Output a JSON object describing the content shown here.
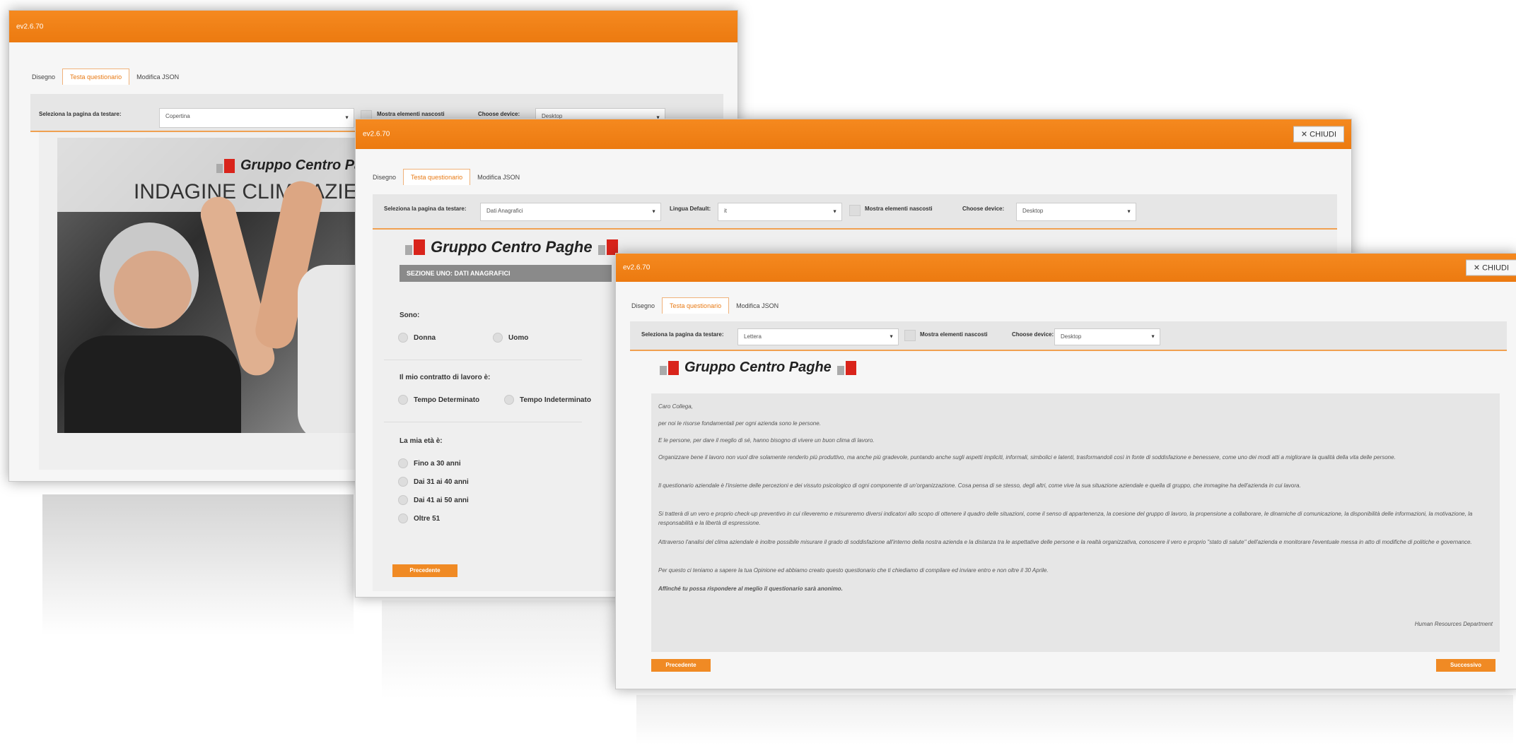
{
  "window1": {
    "version": "ev2.6.70",
    "tabs": [
      "Disegno",
      "Testa questionario",
      "Modifica JSON"
    ],
    "page_label": "Seleziona la pagina da testare:",
    "page_value": "Copertina",
    "show_hidden_label": "Mostra elementi nascosti",
    "device_label": "Choose device:",
    "device_value": "Desktop",
    "brand": "Gruppo Centro Paghe",
    "cover_title": "INDAGINE CLIMA AZIEN"
  },
  "window2": {
    "version": "ev2.6.70",
    "close_label": "CHIUDI",
    "tabs": [
      "Disegno",
      "Testa questionario",
      "Modifica JSON"
    ],
    "page_label": "Seleziona la pagina da testare:",
    "page_value": "Dati Anagrafici",
    "lang_label": "Lingua Default:",
    "lang_value": "it",
    "show_hidden_label": "Mostra elementi nascosti",
    "device_label": "Choose device:",
    "device_value": "Desktop",
    "brand": "Gruppo Centro Paghe",
    "section_title": "SEZIONE UNO: DATI ANAGRAFICI",
    "q1": "Sono:",
    "q1_options": [
      "Donna",
      "Uomo"
    ],
    "q2": "Il mio contratto di lavoro è:",
    "q2_options": [
      "Tempo Determinato",
      "Tempo Indeterminato"
    ],
    "q3": "La mia età è:",
    "q3_options": [
      "Fino a 30 anni",
      "Dai 31 ai 40 anni",
      "Dai 41 ai 50 anni",
      "Oltre 51"
    ],
    "prev_label": "Precedente"
  },
  "window3": {
    "version": "ev2.6.70",
    "close_label": "CHIUDI",
    "tabs": [
      "Disegno",
      "Testa questionario",
      "Modifica JSON"
    ],
    "page_label": "Seleziona la pagina da testare:",
    "page_value": "Lettera",
    "show_hidden_label": "Mostra elementi nascosti",
    "device_label": "Choose device:",
    "device_value": "Desktop",
    "brand": "Gruppo Centro Paghe",
    "letter": [
      "Caro Collega,",
      "per noi le risorse fondamentali per ogni azienda sono le persone.",
      "E le persone, per dare il meglio di sé, hanno bisogno di vivere un buon clima di lavoro.",
      "Organizzare bene il lavoro non vuol dire solamente renderlo più produttivo, ma anche più gradevole, puntando anche sugli aspetti impliciti, informali, simbolici e latenti, trasformandoli così in fonte di soddisfazione e benessere, come uno dei modi atti a migliorare la qualità della vita delle persone.",
      "Il questionario aziendale è l'insieme delle percezioni e dei vissuto psicologico di ogni componente di un'organizzazione. Cosa pensa di se stesso, degli altri, come vive la sua situazione aziendale e quella di gruppo, che immagine ha dell'azienda in cui lavora.",
      "Si tratterà di un vero e proprio check-up preventivo in cui rileveremo e misureremo diversi indicatori allo scopo di ottenere il quadro delle situazioni, come il senso di appartenenza, la coesione del gruppo di lavoro, la propensione a collaborare, le dinamiche di comunicazione, la disponibilità delle informazioni, la motivazione, la responsabilità e la libertà di espressione.",
      "Attraverso l'analisi del clima aziendale è inoltre possibile misurare il grado di soddisfazione all'interno della nostra azienda e la distanza tra le aspettative delle persone e la realtà organizzativa, conoscere il vero e proprio \"stato di salute\" dell'azienda e monitorare l'eventuale messa in atto di modifiche di politiche e governance.",
      "Per questo ci teniamo a sapere la tua Opinione ed abbiamo creato questo questionario che ti chiediamo di compilare ed inviare entro e non oltre il 30 Aprile.",
      "Affinché tu possa rispondere al meglio il questionario sarà anonimo."
    ],
    "signature": "Human Resources Department",
    "prev_label": "Precedente",
    "next_label": "Successivo"
  },
  "colors": {
    "accent": "#f08a24",
    "logo_red": "#d9241b",
    "section_bar": "#8a8a8a"
  }
}
